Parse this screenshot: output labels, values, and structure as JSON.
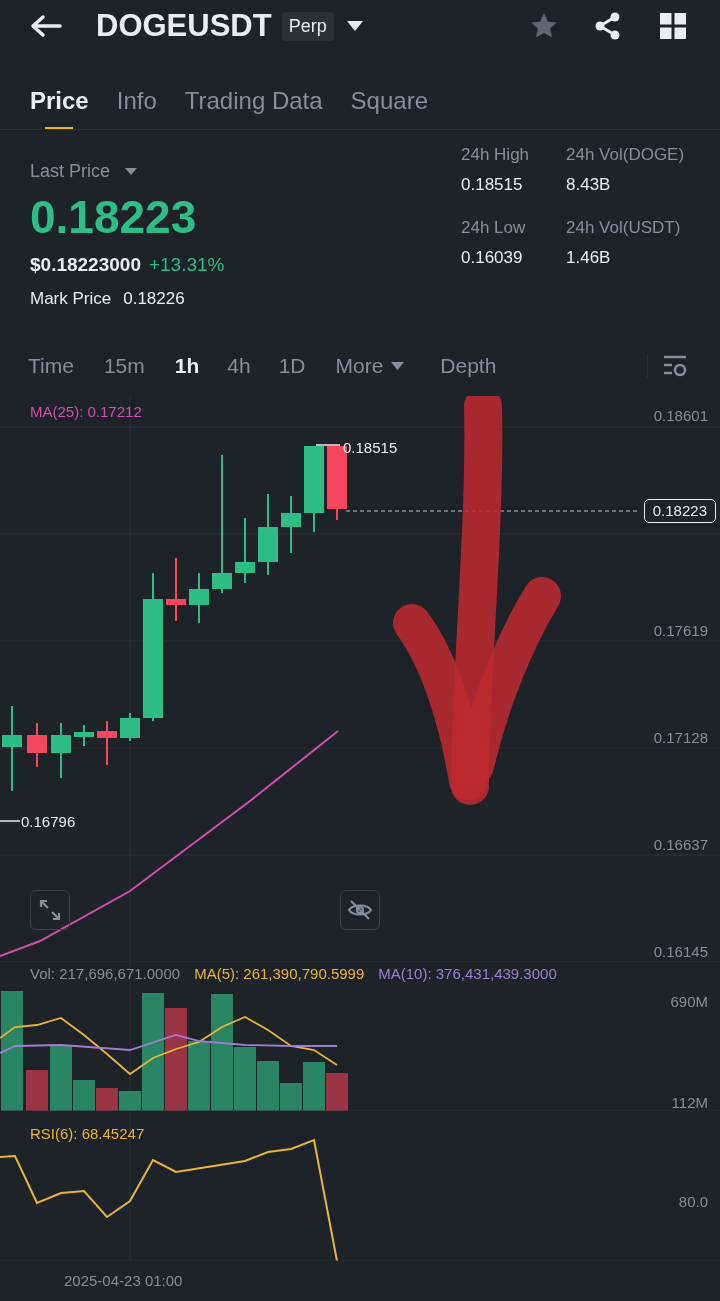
{
  "header": {
    "symbol": "DOGEUSDT",
    "badge": "Perp"
  },
  "tabs": [
    {
      "label": "Price",
      "selected": true
    },
    {
      "label": "Info",
      "selected": false
    },
    {
      "label": "Trading Data",
      "selected": false
    },
    {
      "label": "Square",
      "selected": false
    }
  ],
  "ticker": {
    "last_price_label": "Last Price",
    "last_price": "0.18223",
    "usd_price": "$0.18223000",
    "change": "+13.31%",
    "mark_price_label": "Mark Price",
    "mark_price": "0.18226"
  },
  "stats": [
    {
      "label": "24h High",
      "value": "0.18515"
    },
    {
      "label": "24h Vol(DOGE)",
      "value": "8.43B"
    },
    {
      "label": "24h Low",
      "value": "0.16039"
    },
    {
      "label": "24h Vol(USDT)",
      "value": "1.46B"
    }
  ],
  "intervals": [
    {
      "label": "Time",
      "selected": false
    },
    {
      "label": "15m",
      "selected": false
    },
    {
      "label": "1h",
      "selected": true
    },
    {
      "label": "4h",
      "selected": false
    },
    {
      "label": "1D",
      "selected": false
    }
  ],
  "more": {
    "label": "More"
  },
  "depth": {
    "label": "Depth"
  },
  "price_chart": {
    "indicator": "MA(25): 0.17212",
    "axis_labels": [
      "0.18601",
      "0.17619",
      "0.17128",
      "0.16637",
      "0.16145"
    ],
    "last_price_tag": "0.18223",
    "high_marker": "0.18515",
    "low_marker": "0.16796"
  },
  "volume": {
    "vol": "Vol: 217,696,671.0000",
    "ma5": "MA(5): 261,390,790.5999",
    "ma10": "MA(10): 376,431,439.3000",
    "axis_labels": [
      "690M",
      "112M"
    ]
  },
  "rsi": {
    "label": "RSI(6): 68.45247",
    "axis_labels": [
      "80.0"
    ]
  },
  "time_axis": {
    "label": "2025-04-23 01:00"
  }
}
